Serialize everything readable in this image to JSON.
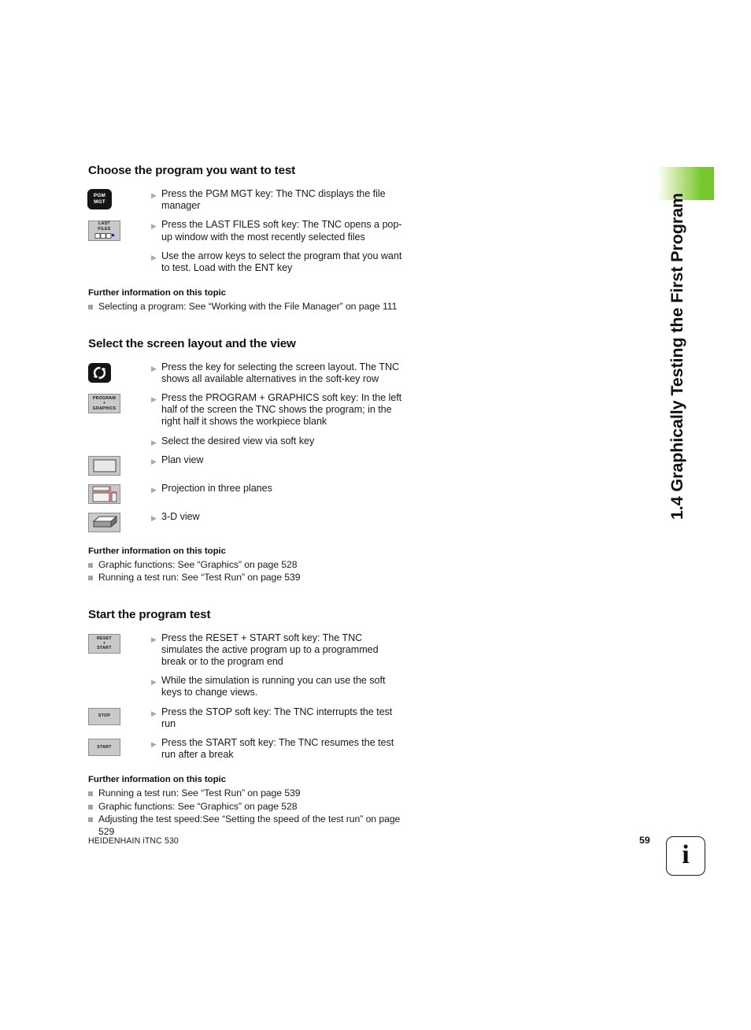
{
  "chapter": {
    "tab_label": "1.4 Graphically Testing the First Program"
  },
  "sections": [
    {
      "heading": "Choose the program you want to test",
      "steps": [
        {
          "key": {
            "type": "hardkey",
            "lines": [
              "PGM",
              "MGT"
            ],
            "name": "pgm-mgt-key"
          },
          "text": "Press the PGM MGT key: The TNC displays the file manager"
        },
        {
          "key": {
            "type": "softkey-last-files",
            "lines": [
              "LAST",
              "FILES"
            ],
            "name": "last-files-softkey"
          },
          "text": "Press the LAST FILES soft key: The TNC opens a pop-up window with the most recently selected files"
        },
        {
          "key": null,
          "text": "Use the arrow keys to select the program that you want to test. Load with the ENT key"
        }
      ],
      "further_heading": "Further information on this topic",
      "further_items": [
        "Selecting a program: See “Working with the File Manager” on page 111"
      ]
    },
    {
      "heading": "Select the screen layout and the view",
      "steps": [
        {
          "key": {
            "type": "layout-key",
            "name": "screen-layout-key"
          },
          "text": "Press the key for selecting the screen layout. The TNC shows all available alternatives in the soft-key row"
        },
        {
          "key": {
            "type": "softkey",
            "lines": [
              "PROGRAM",
              "+",
              "GRAPHICS"
            ],
            "name": "program-graphics-softkey"
          },
          "text": "Press the PROGRAM + GRAPHICS soft key: In the left half of the screen the TNC shows the program; in the right half it shows the workpiece blank"
        },
        {
          "key": null,
          "text": "Select the desired view via soft key"
        },
        {
          "key": {
            "type": "view-plan",
            "name": "plan-view-softkey"
          },
          "text": "Plan view"
        },
        {
          "key": {
            "type": "view-three-planes",
            "name": "three-planes-softkey"
          },
          "text": "Projection in three planes"
        },
        {
          "key": {
            "type": "view-3d",
            "name": "three-d-view-softkey"
          },
          "text": "3-D view"
        }
      ],
      "further_heading": "Further information on this topic",
      "further_items": [
        "Graphic functions: See “Graphics” on page 528",
        "Running a test run: See “Test Run” on page 539"
      ]
    },
    {
      "heading": "Start the program test",
      "steps": [
        {
          "key": {
            "type": "softkey",
            "lines": [
              "RESET",
              "+",
              "START"
            ],
            "name": "reset-start-softkey"
          },
          "text": "Press the RESET + START soft key: The TNC simulates the active program up to a programmed break or to the program end"
        },
        {
          "key": null,
          "text": "While the simulation is running you can use the soft keys to change views."
        },
        {
          "key": {
            "type": "softkey",
            "lines": [
              "STOP"
            ],
            "name": "stop-softkey"
          },
          "text": "Press the STOP soft key: The TNC interrupts the test run"
        },
        {
          "key": {
            "type": "softkey",
            "lines": [
              "START"
            ],
            "name": "start-softkey"
          },
          "text": "Press the START soft key: The TNC resumes the test run after a break"
        }
      ],
      "further_heading": "Further information on this topic",
      "further_items": [
        "Running a test run: See “Test Run” on page 539",
        "Graphic functions: See “Graphics” on page 528",
        "Adjusting the test speed:See “Setting the speed of the test run” on page 529"
      ]
    }
  ],
  "footer": {
    "brand": "HEIDENHAIN iTNC 530",
    "page_number": "59",
    "info_glyph": "i"
  },
  "colors": {
    "accent_green": "#76c82e",
    "bullet_gray": "#a2a2a2",
    "softkey_fill": "#c9c9c9",
    "hardkey_fill": "#151515"
  }
}
